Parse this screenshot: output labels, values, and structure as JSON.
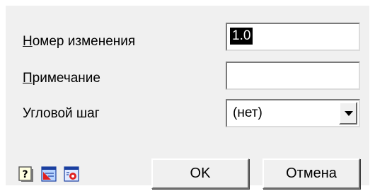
{
  "fields": {
    "change_number": {
      "label_hotkey": "Н",
      "label_rest": "омер изменения",
      "value": "1.0"
    },
    "note": {
      "label_hotkey": "П",
      "label_rest": "римечание",
      "value": ""
    },
    "angle_step": {
      "label": "Угловой шаг",
      "selected": "(нет)"
    }
  },
  "icons": [
    "help-icon",
    "drawing-icon",
    "settings-icon"
  ],
  "buttons": {
    "ok": "OK",
    "cancel": "Отмена"
  }
}
